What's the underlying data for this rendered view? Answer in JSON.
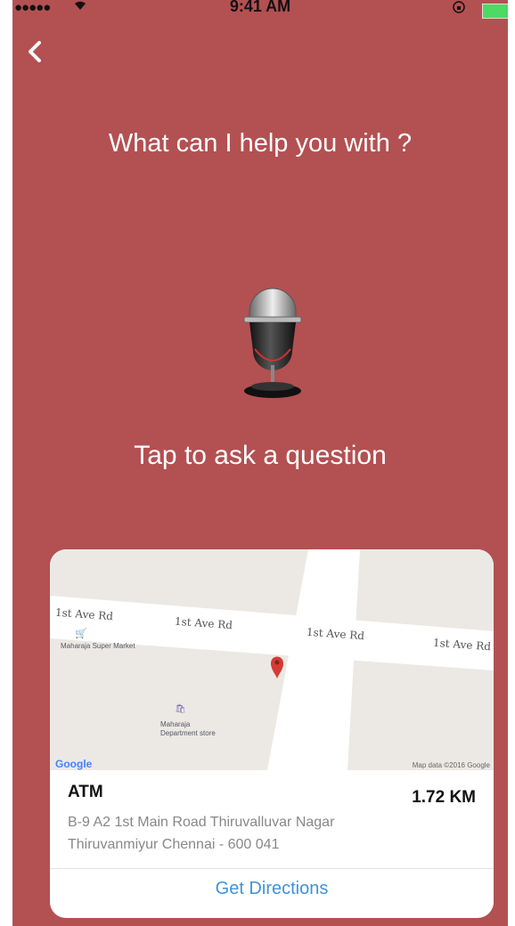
{
  "status_bar": {
    "signal": "●●●●●",
    "wifi": "wifi-icon",
    "time": "9:41 AM",
    "lock": "rotation-lock-icon",
    "battery": "battery-icon"
  },
  "header": {
    "back_icon": "chevron-left-icon"
  },
  "prompt": {
    "title": "What can I help you with ?",
    "tap_label": "Tap to ask a question",
    "mic_icon": "microphone-icon"
  },
  "card": {
    "map": {
      "road_labels": [
        "1st Ave Rd",
        "1st Ave Rd",
        "1st Ave Rd",
        "1st Ave Rd"
      ],
      "poi_1": "Maharaja Super Market",
      "poi_2_line1": "Maharaja",
      "poi_2_line2": "Department store",
      "google": "Google",
      "map_data": "Map data ©2016 Google"
    },
    "place_name": "ATM",
    "distance": "1.72 KM",
    "address_line1": "B-9 A2 1st Main Road Thiruvalluvar Nagar",
    "address_line2": "Thiruvanmiyur Chennai - 600 041",
    "directions_label": "Get Directions"
  },
  "colors": {
    "background": "#b35052",
    "link": "#3f93d8",
    "battery": "#4cd964"
  }
}
